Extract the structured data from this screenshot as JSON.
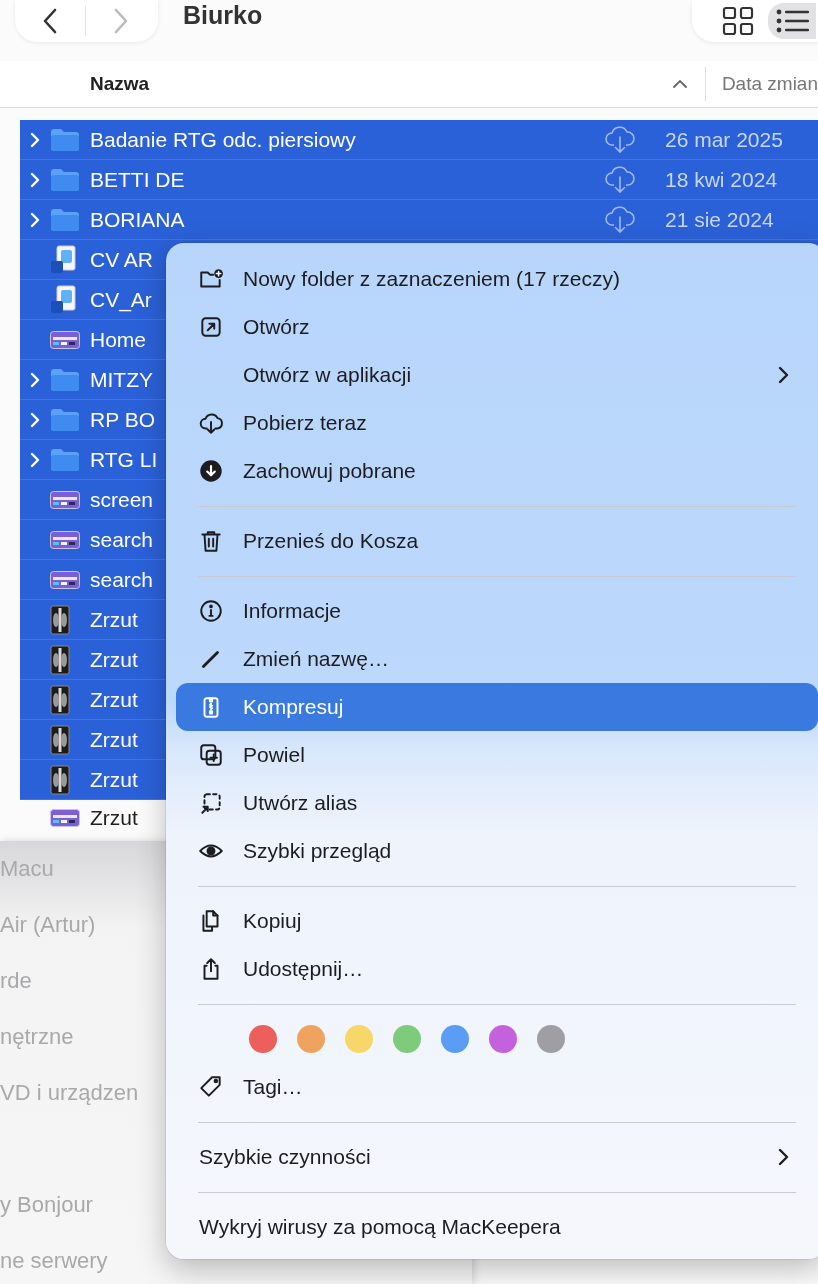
{
  "toolbar": {
    "navigation": [
      {
        "disabled": false
      },
      {
        "disabled": true
      }
    ],
    "title": "Biurko",
    "view_buttons": [
      {
        "selected": false
      },
      {
        "selected": true
      }
    ]
  },
  "columns": [
    {
      "label": "Nazwa",
      "sorted": true
    },
    {
      "label": "Data zmian",
      "sorted": false
    }
  ],
  "files": [
    {
      "name": "Badanie RTG odc. piersiowy",
      "kind": "folder",
      "cloud": true,
      "date": "26 mar 2025",
      "selected": true
    },
    {
      "name": "BETTI DE",
      "kind": "folder",
      "cloud": true,
      "date": "18 kwi 2024",
      "selected": true
    },
    {
      "name": "BORIANA",
      "kind": "folder",
      "cloud": true,
      "date": "21 sie 2024",
      "selected": true
    },
    {
      "name": "CV AR",
      "kind": "document",
      "selected": true
    },
    {
      "name": "CV_Ar",
      "kind": "document",
      "selected": true
    },
    {
      "name": "Home",
      "kind": "screenshot",
      "selected": true
    },
    {
      "name": "MITZY",
      "kind": "folder",
      "selected": true
    },
    {
      "name": "RP BO",
      "kind": "folder",
      "selected": true
    },
    {
      "name": "RTG LI",
      "kind": "folder",
      "selected": true
    },
    {
      "name": "screen",
      "kind": "screenshot",
      "selected": true
    },
    {
      "name": "search",
      "kind": "screenshot",
      "selected": true
    },
    {
      "name": "search",
      "kind": "screenshot",
      "selected": true
    },
    {
      "name": "Zrzut",
      "kind": "xray",
      "selected": true
    },
    {
      "name": "Zrzut",
      "kind": "xray",
      "selected": true
    },
    {
      "name": "Zrzut",
      "kind": "xray",
      "selected": true
    },
    {
      "name": "Zrzut",
      "kind": "xray",
      "selected": true
    },
    {
      "name": "Zrzut",
      "kind": "xray",
      "selected": true
    },
    {
      "name": "Zrzut",
      "kind": "screenshot",
      "selected": false
    }
  ],
  "sidebar": {
    "sections": [
      {
        "items": [
          "Macu",
          "Air (Artur)",
          "rde",
          "nętrzne",
          "VD i urządzen"
        ]
      },
      {
        "items": [
          "y Bonjour",
          "ne serwery"
        ]
      }
    ]
  },
  "context_menu": {
    "items": [
      {
        "kind": "item",
        "label": "Nowy folder z zaznaczeniem (17 rzeczy)",
        "submenu": false,
        "selected": false
      },
      {
        "kind": "item",
        "label": "Otwórz",
        "submenu": false,
        "selected": false
      },
      {
        "kind": "item",
        "label": "Otwórz w aplikacji",
        "submenu": true,
        "selected": false
      },
      {
        "kind": "item",
        "label": "Pobierz teraz",
        "submenu": false,
        "selected": false
      },
      {
        "kind": "item",
        "label": "Zachowuj pobrane",
        "submenu": false,
        "selected": false
      },
      {
        "kind": "separator"
      },
      {
        "kind": "item",
        "label": "Przenieś do Kosza",
        "submenu": false,
        "selected": false
      },
      {
        "kind": "separator"
      },
      {
        "kind": "item",
        "label": "Informacje",
        "submenu": false,
        "selected": false
      },
      {
        "kind": "item",
        "label": "Zmień nazwę…",
        "submenu": false,
        "selected": false
      },
      {
        "kind": "item",
        "label": "Kompresuj",
        "submenu": false,
        "selected": true
      },
      {
        "kind": "item",
        "label": "Powiel",
        "submenu": false,
        "selected": false
      },
      {
        "kind": "item",
        "label": "Utwórz alias",
        "submenu": false,
        "selected": false
      },
      {
        "kind": "item",
        "label": "Szybki przegląd",
        "submenu": false,
        "selected": false
      },
      {
        "kind": "separator"
      },
      {
        "kind": "item",
        "label": "Kopiuj",
        "submenu": false,
        "selected": false
      },
      {
        "kind": "item",
        "label": "Udostępnij…",
        "submenu": false,
        "selected": false
      },
      {
        "kind": "separator"
      },
      {
        "kind": "tags",
        "colors": [
          {
            "color": "#ec5f5d"
          },
          {
            "color": "#f0a35e"
          },
          {
            "color": "#f7d76a"
          },
          {
            "color": "#7dcb7b"
          },
          {
            "color": "#5b9cf5"
          },
          {
            "color": "#c462dd"
          },
          {
            "color": "#9e9ea3"
          }
        ]
      },
      {
        "kind": "item",
        "label": "Tagi…",
        "submenu": false,
        "selected": false
      },
      {
        "kind": "separator"
      },
      {
        "kind": "plain",
        "label": "Szybkie czynności",
        "submenu": true,
        "selected": false
      },
      {
        "kind": "separator"
      },
      {
        "kind": "plain",
        "label": "Wykryj wirusy za pomocą MacKeepera",
        "submenu": false,
        "selected": false
      }
    ]
  }
}
